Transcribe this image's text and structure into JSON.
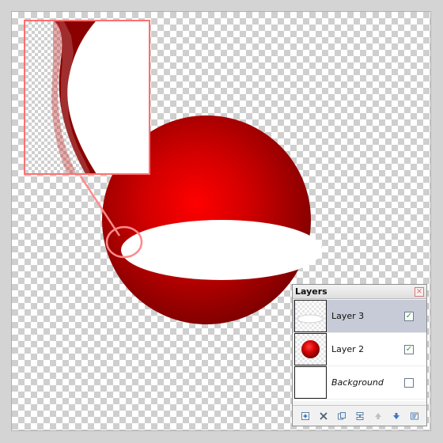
{
  "app": {
    "canvas": {
      "inset": {
        "name": "zoom-inset"
      }
    }
  },
  "layers_panel": {
    "title": "Layers",
    "close_icon": "×",
    "items": [
      {
        "label": "Layer 3",
        "selected": true,
        "visible": true,
        "check_symbol": "✓"
      },
      {
        "label": "Layer 2",
        "selected": false,
        "visible": true,
        "check_symbol": "✓"
      },
      {
        "label": "Background",
        "selected": false,
        "visible": false,
        "check_symbol": ""
      }
    ],
    "toolbar": [
      "add-layer-icon",
      "delete-layer-icon",
      "duplicate-layer-icon",
      "merge-layer-icon",
      "move-up-icon",
      "move-down-icon",
      "properties-icon"
    ]
  },
  "colors": {
    "accent": "#ff6f6f",
    "sphere_red": "#ff0000",
    "sphere_dark": "#8f0000"
  }
}
